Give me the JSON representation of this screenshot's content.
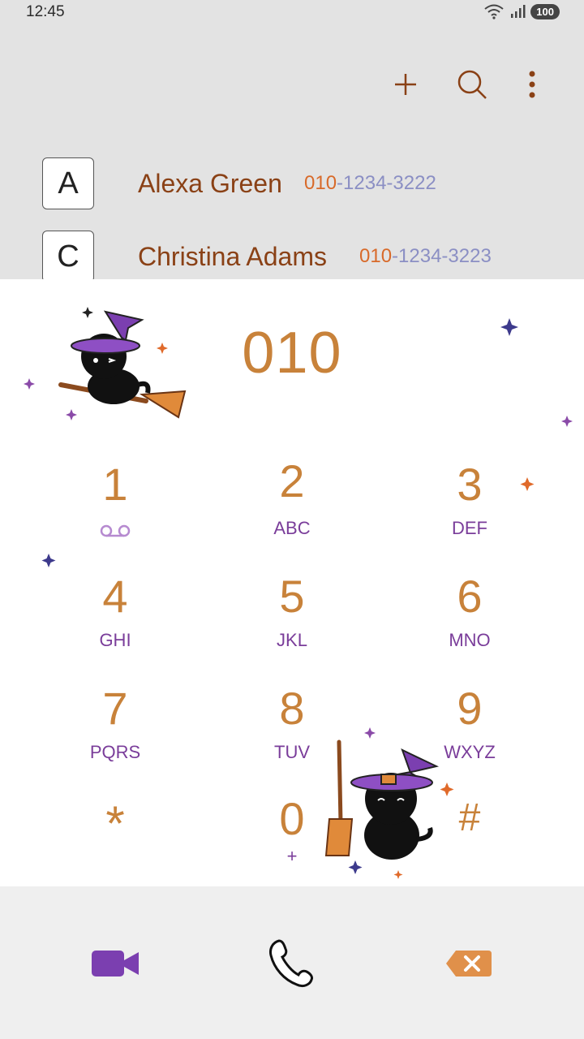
{
  "status": {
    "time": "12:45",
    "battery": "100"
  },
  "toolbar": {
    "add_icon": "plus-icon",
    "search_icon": "search-icon",
    "more_icon": "more-vert-icon"
  },
  "contacts": [
    {
      "letter": "A",
      "name": "Alexa Green",
      "prefix": "010",
      "number_rest": "-1234-3222"
    },
    {
      "letter": "C",
      "name": "Christina Adams",
      "prefix": "010",
      "number_rest": "-1234-3223"
    }
  ],
  "dialer": {
    "display": "010",
    "keys": [
      {
        "digit": "1",
        "letters": ""
      },
      {
        "digit": "2",
        "letters": "ABC"
      },
      {
        "digit": "3",
        "letters": "DEF"
      },
      {
        "digit": "4",
        "letters": "GHI"
      },
      {
        "digit": "5",
        "letters": "JKL"
      },
      {
        "digit": "6",
        "letters": "MNO"
      },
      {
        "digit": "7",
        "letters": "PQRS"
      },
      {
        "digit": "8",
        "letters": "TUV"
      },
      {
        "digit": "9",
        "letters": "WXYZ"
      },
      {
        "digit": "*",
        "letters": ""
      },
      {
        "digit": "0",
        "letters": "+"
      },
      {
        "digit": "#",
        "letters": ""
      }
    ]
  },
  "bottom": {
    "video_icon": "video-call-icon",
    "call_icon": "phone-icon",
    "delete_icon": "backspace-icon"
  },
  "colors": {
    "accent": "#c8823a",
    "purple": "#7a3d9a",
    "name": "#8a4116",
    "number_gray": "#8b8fc4"
  }
}
